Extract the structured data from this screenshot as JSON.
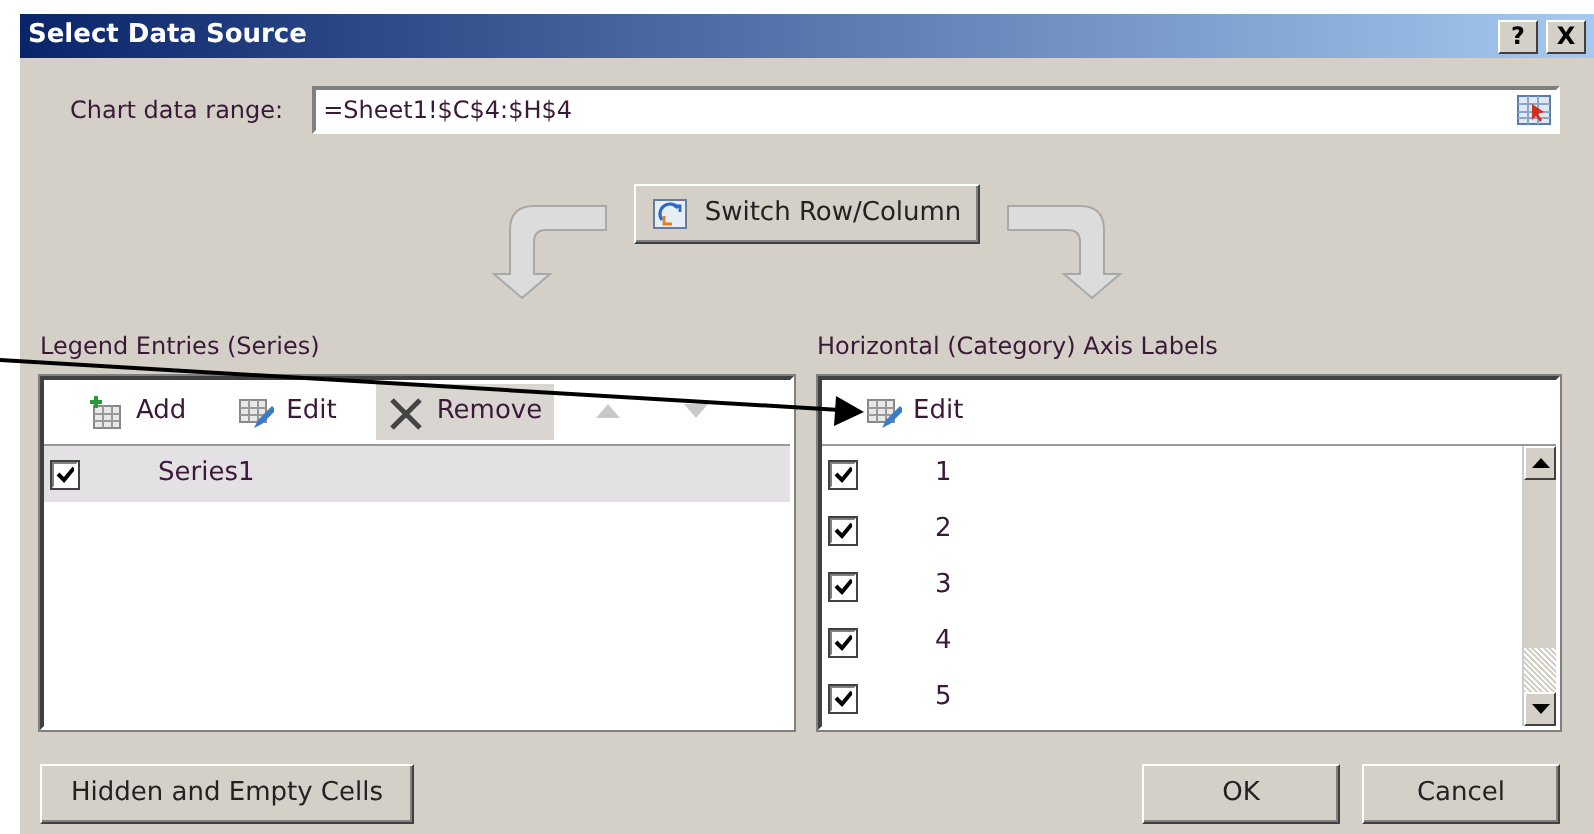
{
  "window": {
    "title": "Select Data Source",
    "controls": [
      "?",
      "X"
    ]
  },
  "chart_data_range": {
    "label": "Chart data range:",
    "value": "=Sheet1!$C$4:$H$4"
  },
  "switch_button": {
    "label": "Switch Row/Column"
  },
  "legend_entries": {
    "label": "Legend Entries (Series)",
    "toolbar": [
      {
        "kind": "add",
        "label": "Add",
        "disabled": false,
        "hovered": false
      },
      {
        "kind": "edit",
        "label": "Edit",
        "disabled": false,
        "hovered": false
      },
      {
        "kind": "remove",
        "label": "Remove",
        "disabled": false,
        "hovered": true
      },
      {
        "kind": "move_up",
        "disabled": true,
        "hovered": false
      },
      {
        "kind": "move_down",
        "disabled": true,
        "hovered": false
      }
    ],
    "items": [
      {
        "label": "Series1",
        "checked": true,
        "selected": true
      }
    ]
  },
  "axis_labels": {
    "label": "Horizontal (Category) Axis Labels",
    "toolbar": [
      {
        "kind": "edit",
        "label": "Edit",
        "disabled": false,
        "hovered": false
      }
    ],
    "items": [
      {
        "label": "1",
        "checked": true,
        "selected": false
      },
      {
        "label": "2",
        "checked": true,
        "selected": false
      },
      {
        "label": "3",
        "checked": true,
        "selected": false
      },
      {
        "label": "4",
        "checked": true,
        "selected": false
      },
      {
        "label": "5",
        "checked": true,
        "selected": false
      }
    ]
  },
  "buttons": [
    {
      "kind": "hidden_cells",
      "label": "Hidden and Empty Cells"
    },
    {
      "kind": "ok",
      "label": "OK"
    },
    {
      "kind": "cancel",
      "label": "Cancel"
    }
  ]
}
